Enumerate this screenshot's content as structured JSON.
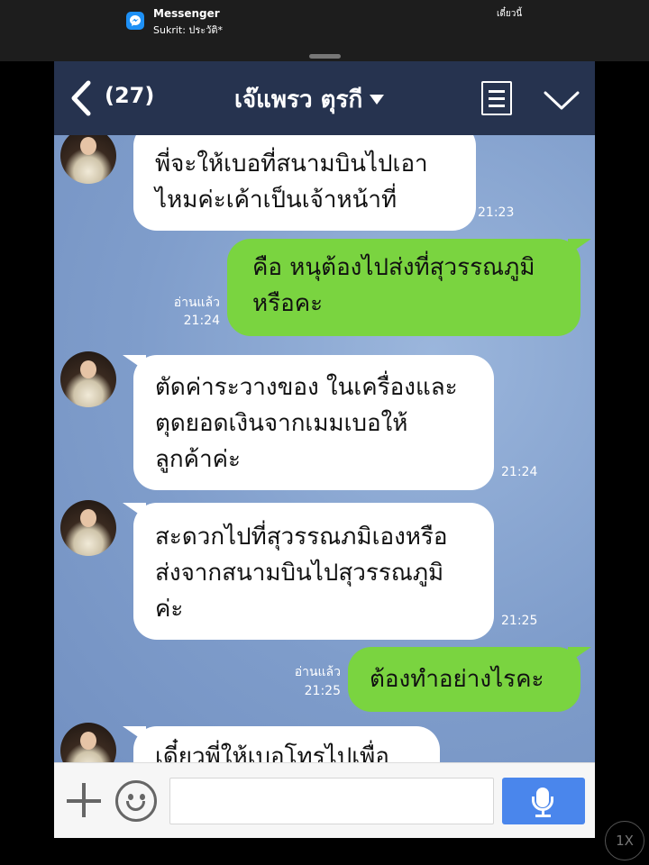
{
  "notification": {
    "app": "Messenger",
    "message": "Sukrit: ประวัติ*",
    "time": "เดี๋ยวนี้",
    "icon": "messenger-icon",
    "accent": "#1e90f5"
  },
  "header": {
    "unread_count": "(27)",
    "title": "เจ๊แพรว ตุรกี",
    "icons": [
      "back-chevron-icon",
      "dropdown-caret-icon",
      "notes-icon",
      "collapse-chevron-icon"
    ],
    "background": "#26334f"
  },
  "messages": [
    {
      "side": "in",
      "lines": [
        "พี่จะให้เบอที่สนามบินไปเอา",
        "ไหมค่ะเค้าเป็นเจ้าหน้าที่"
      ],
      "time": "21:23"
    },
    {
      "side": "out",
      "lines": [
        "คือ หนุต้องไปส่งที่สุวรรณภูมิ",
        "หรือคะ"
      ],
      "read": "อ่านแล้ว",
      "time": "21:24"
    },
    {
      "side": "in",
      "lines": [
        "ตัดค่าระวางของ ในเครื่องและ",
        "ตุดยอดเงินจากเมมเบอให้",
        "ลูกค้าค่ะ"
      ],
      "time": "21:24"
    },
    {
      "side": "in",
      "lines": [
        "สะดวกไปที่สุวรรณภมิเองหรือ",
        "ส่งจากสนามบินไปสุวรรณภูมิ",
        "ค่ะ"
      ],
      "time": "21:25"
    },
    {
      "side": "out",
      "lines": [
        "ต้องทำอย่างไรคะ"
      ],
      "read": "อ่านแล้ว",
      "time": "21:25"
    },
    {
      "side": "in",
      "lines": [
        "เดี๋ยวพี่ให้เบอโทรไปเพื่อ"
      ],
      "time": ""
    }
  ],
  "colors": {
    "incoming": "#ffffff",
    "outgoing": "#7ad440",
    "chat_bg": "#7d9cca",
    "mic_button": "#4a86ec"
  },
  "input": {
    "value": "",
    "placeholder": ""
  },
  "input_icons": [
    "plus-icon",
    "emoji-icon",
    "microphone-icon"
  ],
  "overlay": {
    "speed_label": "1X"
  }
}
